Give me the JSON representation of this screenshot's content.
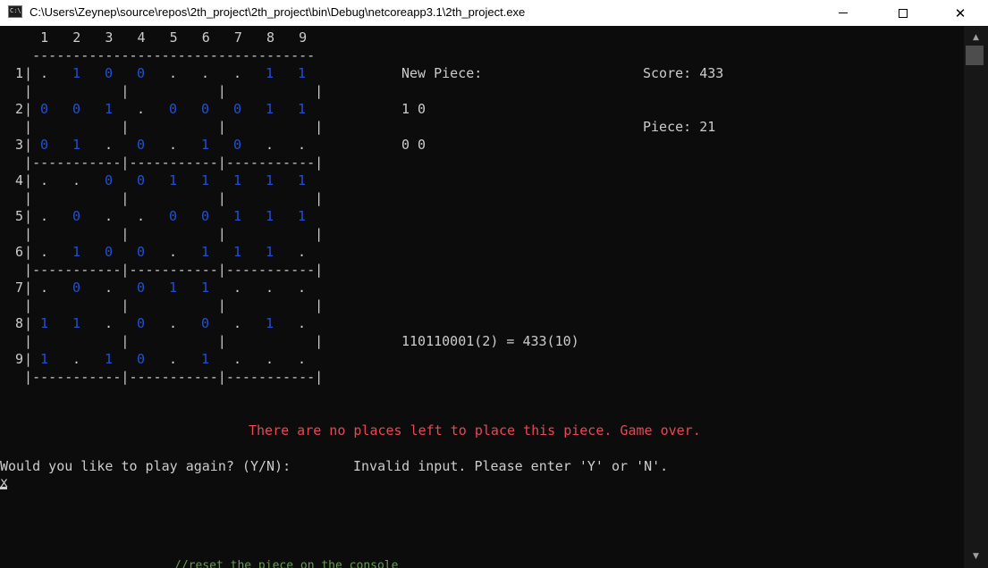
{
  "window": {
    "title": "C:\\Users\\Zeynep\\source\\repos\\2th_project\\2th_project\\bin\\Debug\\netcoreapp3.1\\2th_project.exe",
    "icon_label": "C:\\",
    "minimize": "minimize-icon",
    "maximize": "maximize-icon",
    "close": "✕"
  },
  "board": {
    "column_header": "     1   2   3   4   5   6   7   8   9",
    "top_rule": "    -----------------------------------",
    "row_numbers": [
      "1",
      "2",
      "3",
      "4",
      "5",
      "6",
      "7",
      "8",
      "9"
    ],
    "inner_separator": "  |           |           |           |",
    "block_separator": "  |-----------|-----------|-----------|",
    "rows": [
      [
        ".",
        "1",
        "0",
        "0",
        ".",
        ".",
        ".",
        "1",
        "1"
      ],
      [
        "0",
        "0",
        "1",
        ".",
        "0",
        "0",
        "0",
        "1",
        "1"
      ],
      [
        "0",
        "1",
        ".",
        "0",
        ".",
        "1",
        "0",
        ".",
        "."
      ],
      [
        ".",
        ".",
        "0",
        "0",
        "1",
        "1",
        "1",
        "1",
        "1"
      ],
      [
        ".",
        "0",
        ".",
        ".",
        "0",
        "0",
        "1",
        "1",
        "1"
      ],
      [
        ".",
        "1",
        "0",
        "0",
        ".",
        "1",
        "1",
        "1",
        "."
      ],
      [
        ".",
        "0",
        ".",
        "0",
        "1",
        "1",
        ".",
        ".",
        "."
      ],
      [
        "1",
        "1",
        ".",
        "0",
        ".",
        "0",
        ".",
        "1",
        "."
      ],
      [
        "1",
        ".",
        "1",
        "0",
        ".",
        "1",
        ".",
        ".",
        "."
      ]
    ]
  },
  "panel": {
    "new_piece_label": "New Piece:",
    "piece_row1": "1 0",
    "piece_row2": "0 0",
    "score": "Score: 433",
    "piece_count": "Piece: 21",
    "conversion": "110110001(2) = 433(10)"
  },
  "messages": {
    "game_over": "There are no places left to place this piece. Game over.",
    "prompt": "Would you like to play again? (Y/N):",
    "invalid": "Invalid input. Please enter 'Y' or 'N'.",
    "user_input": "x"
  },
  "editor_behind": "//reset the piece on the console",
  "colors": {
    "background": "#0c0c0c",
    "text": "#cccccc",
    "cell_on": "#2050d8",
    "error": "#e74856"
  },
  "scrollbar": {
    "up_icon": "▲",
    "down_icon": "▼"
  }
}
